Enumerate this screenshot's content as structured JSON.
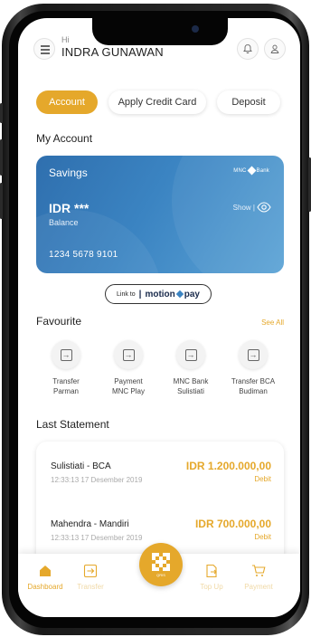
{
  "header": {
    "greeting": "Hi",
    "user_name": "INDRA GUNAWAN",
    "menu_icon": "hamburger-menu-icon",
    "notification_icon": "bell-icon",
    "profile_icon": "user-icon"
  },
  "tabs": [
    {
      "label": "Account",
      "active": true
    },
    {
      "label": "Apply Credit Card",
      "active": false
    },
    {
      "label": "Deposit",
      "active": false
    }
  ],
  "my_account": {
    "title": "My Account",
    "card": {
      "type": "Savings",
      "bank_logo": "MNC Bank",
      "amount": "IDR ***",
      "amount_label": "Balance",
      "show_label": "Show",
      "account_number": "1234 5678 9101"
    },
    "link": {
      "prefix": "Link to",
      "brand": "motion",
      "brand_suffix": "pay"
    }
  },
  "favourite": {
    "title": "Favourite",
    "see_all": "See All",
    "items": [
      {
        "line1": "Transfer",
        "line2": "Parman"
      },
      {
        "line1": "Payment",
        "line2": "MNC Play"
      },
      {
        "line1": "MNC Bank",
        "line2": "Sulistiati"
      },
      {
        "line1": "Transfer BCA",
        "line2": "Budiman"
      }
    ]
  },
  "last_statement": {
    "title": "Last Statement",
    "items": [
      {
        "name": "Sulistiati - BCA",
        "datetime": "12:33:13  17 Desember 2019",
        "amount": "IDR 1.200.000,00",
        "type": "Debit"
      },
      {
        "name": "Mahendra - Mandiri",
        "datetime": "12:33:13  17 Desember 2019",
        "amount": "IDR 700.000,00",
        "type": "Debit"
      }
    ]
  },
  "bottom_nav": {
    "items": [
      {
        "label": "Dashboard",
        "icon": "home-icon",
        "active": true
      },
      {
        "label": "Transfer",
        "icon": "transfer-icon",
        "active": false
      },
      {
        "label": "Top Up",
        "icon": "top-up-icon",
        "active": false
      },
      {
        "label": "Payment",
        "icon": "cart-icon",
        "active": false
      }
    ],
    "qr_label": "QRIS"
  },
  "colors": {
    "accent": "#e5a82b",
    "card_blue": "#3b84c2"
  }
}
